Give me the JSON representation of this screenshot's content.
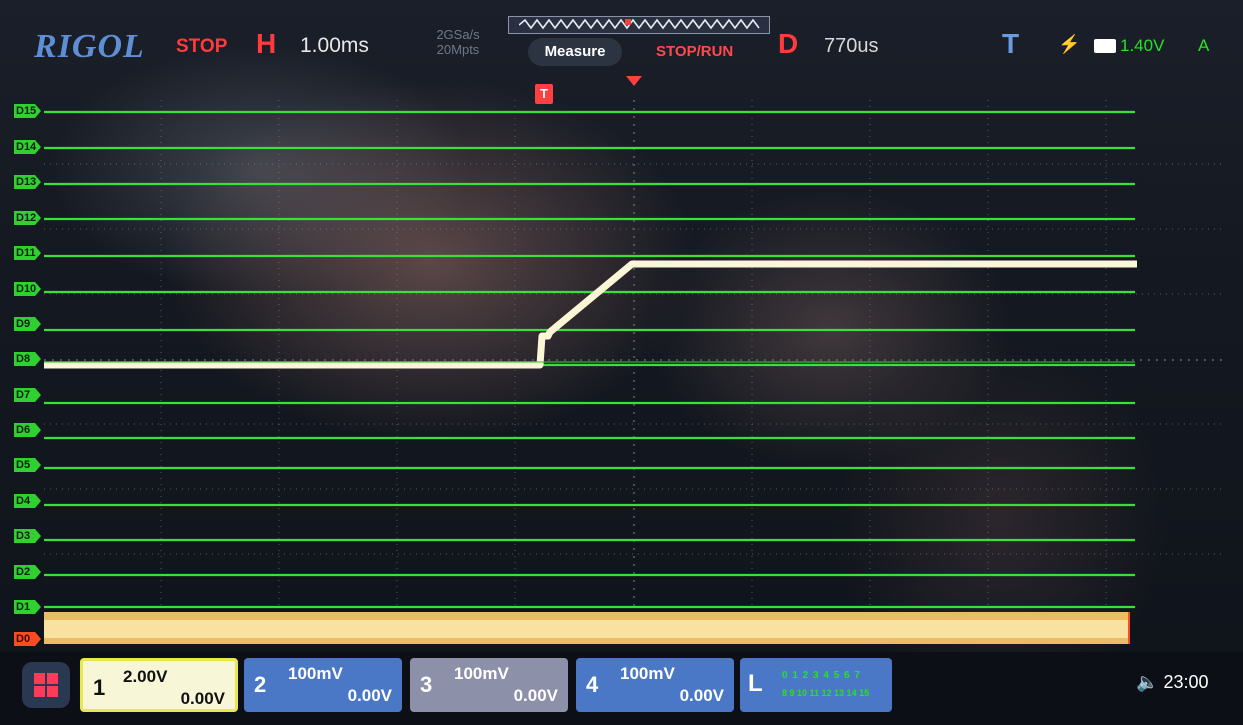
{
  "header": {
    "brand": "RIGOL",
    "run_status": "STOP",
    "horizontal_label": "H",
    "timebase": "1.00ms",
    "sample_rate": "2GSa/s",
    "memory_depth": "20Mpts",
    "measure_button": "Measure",
    "stop_run_button": "STOP/RUN",
    "delay_label": "D",
    "delay_value": "770us",
    "trigger_label": "T",
    "trigger_level": "1.40V",
    "trigger_mode": "A"
  },
  "markers": {
    "trigger_position": "T"
  },
  "digital_channels": [
    "D15",
    "D14",
    "D13",
    "D12",
    "D11",
    "D10",
    "D9",
    "D8",
    "D7",
    "D6",
    "D5",
    "D4",
    "D3",
    "D2",
    "D1",
    "D0"
  ],
  "channels": [
    {
      "id": "ch1",
      "num": "1",
      "scale": "2.00V",
      "offset": "0.00V"
    },
    {
      "id": "ch2",
      "num": "2",
      "scale": "100mV",
      "offset": "0.00V"
    },
    {
      "id": "ch3",
      "num": "3",
      "scale": "100mV",
      "offset": "0.00V"
    },
    {
      "id": "ch4",
      "num": "4",
      "scale": "100mV",
      "offset": "0.00V"
    }
  ],
  "logic": {
    "label": "L",
    "row1": "0 1 2 3 4 5 6 7",
    "row2": "8 9 10 11 12 13 14 15"
  },
  "clock": "23:00",
  "colors": {
    "digital": "#2fd02f",
    "d0": "#ff4a22",
    "ch1": "#f3f0c8",
    "stop": "#ff3b3b",
    "brand": "#5e8fd6",
    "trigger_level": "#28e028"
  }
}
